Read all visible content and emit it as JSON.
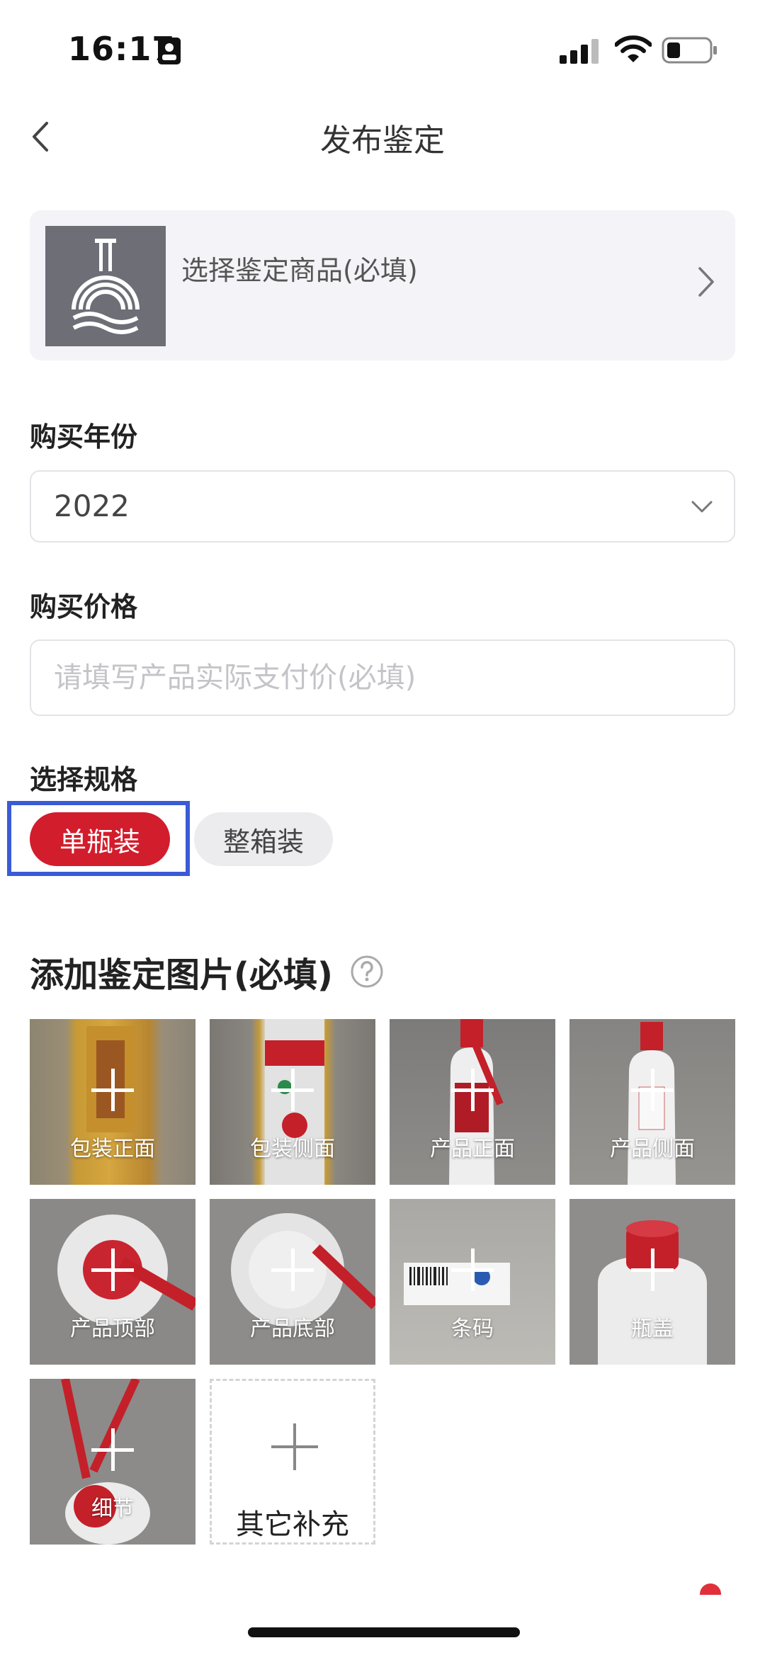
{
  "status_bar": {
    "time": "16:17"
  },
  "nav": {
    "title": "发布鉴定"
  },
  "product": {
    "placeholder": "选择鉴定商品(必填)"
  },
  "purchase_year": {
    "label": "购买年份",
    "value": "2022"
  },
  "purchase_price": {
    "label": "购买价格",
    "placeholder": "请填写产品实际支付价(必填)"
  },
  "spec": {
    "label": "选择规格",
    "options": [
      "单瓶装",
      "整箱装"
    ],
    "selected": "单瓶装"
  },
  "photos": {
    "title": "添加鉴定图片(必填)",
    "tiles": [
      "包装正面",
      "包装侧面",
      "产品正面",
      "产品侧面",
      "产品顶部",
      "产品底部",
      "条码",
      "瓶盖",
      "细节"
    ],
    "add_more": "其它补充"
  },
  "colors": {
    "accent": "#d21d2c",
    "focus_outline": "#3a5bd6"
  }
}
